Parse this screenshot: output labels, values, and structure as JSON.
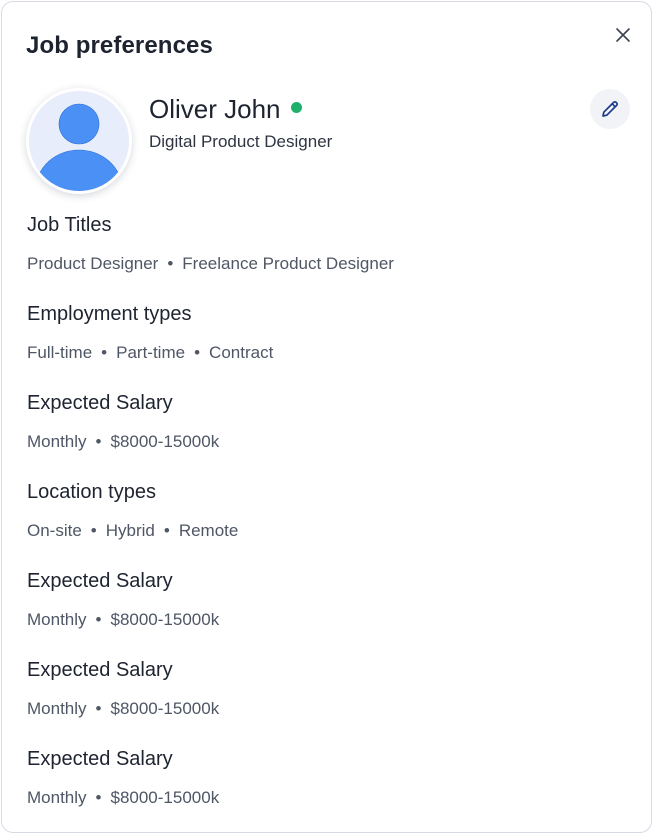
{
  "panel": {
    "title": "Job preferences"
  },
  "profile": {
    "name": "Oliver John",
    "role": "Digital Product Designer",
    "status_color": "#1fb16b"
  },
  "sections": [
    {
      "heading": "Job Titles",
      "values": [
        "Product Designer",
        "Freelance Product Designer"
      ]
    },
    {
      "heading": "Employment types",
      "values": [
        "Full-time",
        "Part-time",
        "Contract"
      ]
    },
    {
      "heading": "Expected Salary",
      "values": [
        "Monthly",
        "$8000-15000k"
      ]
    },
    {
      "heading": "Location types",
      "values": [
        "On-site",
        "Hybrid",
        "Remote"
      ]
    },
    {
      "heading": "Expected Salary",
      "values": [
        "Monthly",
        "$8000-15000k"
      ]
    },
    {
      "heading": "Expected Salary",
      "values": [
        "Monthly",
        "$8000-15000k"
      ]
    },
    {
      "heading": "Expected Salary",
      "values": [
        "Monthly",
        "$8000-15000k"
      ]
    }
  ],
  "separator": "•",
  "icons": {
    "close": "close-icon",
    "edit": "pencil-icon",
    "avatar": "user-avatar-icon"
  }
}
